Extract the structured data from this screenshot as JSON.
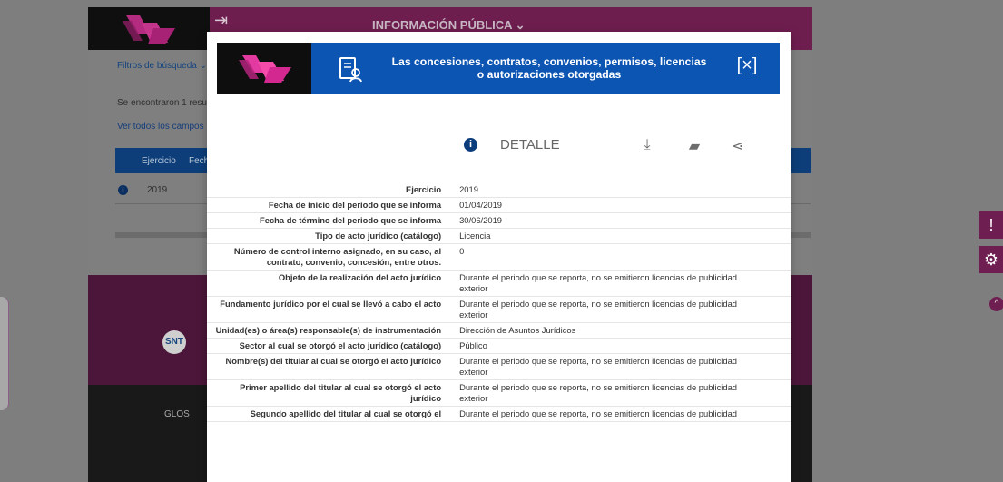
{
  "background": {
    "nav_label": "INFORMACIÓN PÚBLICA ⌄",
    "filters_label": "Filtros de búsqueda ⌄",
    "results_text": "Se encontraron 1 resu",
    "view_all_fields": "Ver todos los campos",
    "table_headers": [
      "Ejercicio",
      "Fech"
    ],
    "table_row_year": "2019",
    "footer_logo_text": "SNT",
    "footer_link": "GLOS"
  },
  "modal": {
    "title_line1": "Las concesiones, contratos, convenios, permisos, licencias",
    "title_line2": "o autorizaciones otorgadas",
    "close_label": "[×]",
    "detail_label": "DETALLE",
    "icons": {
      "info": "info-icon",
      "download": "download-icon",
      "print": "print-icon",
      "share": "share-icon",
      "document": "document-icon",
      "close": "close-icon"
    },
    "rows": [
      {
        "label": "Ejercicio",
        "value": "2019"
      },
      {
        "label": "Fecha de inicio del periodo que se informa",
        "value": "01/04/2019"
      },
      {
        "label": "Fecha de término del periodo que se informa",
        "value": "30/06/2019"
      },
      {
        "label": "Tipo de acto jurídico (catálogo)",
        "value": "Licencia"
      },
      {
        "label": "Número de control interno asignado, en su caso, al contrato, convenio, concesión, entre otros.",
        "value": "0"
      },
      {
        "label": "Objeto de la realización del acto jurídico",
        "value": "Durante el periodo que se reporta, no se emitieron licencias de publicidad exterior"
      },
      {
        "label": "Fundamento jurídico por el cual se llevó a cabo el acto",
        "value": "Durante el periodo que se reporta, no se emitieron licencias de publicidad exterior"
      },
      {
        "label": "Unidad(es) o área(s) responsable(s) de instrumentación",
        "value": "Dirección de Asuntos Jurídicos"
      },
      {
        "label": "Sector al cual se otorgó el acto jurídico (catálogo)",
        "value": "Público"
      },
      {
        "label": "Nombre(s) del titular al cual se otorgó el acto jurídico",
        "value": "Durante el periodo que se reporta, no se emitieron licencias de publicidad exterior"
      },
      {
        "label": "Primer apellido del titular al cual se otorgó el acto jurídico",
        "value": "Durante el periodo que se reporta, no se emitieron licencias de publicidad exterior"
      },
      {
        "label": "Segundo apellido del titular al cual se otorgó el",
        "value": "Durante el periodo que se reporta, no se emitieron licencias de publicidad"
      }
    ]
  },
  "colors": {
    "header_blue": "#0d55b3",
    "brand_magenta": "#6e1d4f",
    "background_overlay": "#7f7f7f"
  }
}
